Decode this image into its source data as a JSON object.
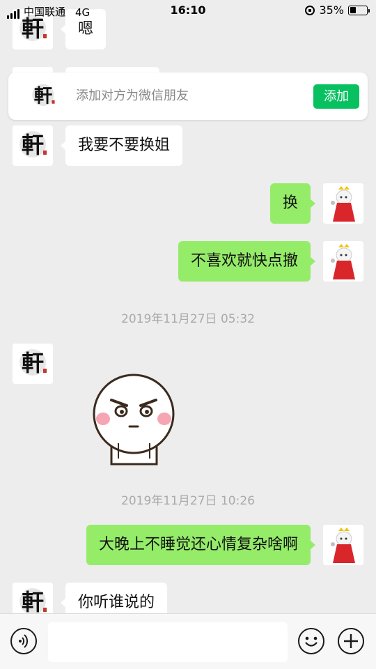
{
  "status_bar": {
    "carrier": "中国联通",
    "network": "4G",
    "time": "16:10",
    "battery_percent_text": "35%",
    "battery_level": 0.35
  },
  "banner": {
    "text": "添加对方为微信朋友",
    "add_label": "添加"
  },
  "messages": [
    {
      "side": "in",
      "text": "嗯"
    },
    {
      "side": "in",
      "text": "我要不要换姐"
    },
    {
      "side": "out",
      "text": "换"
    },
    {
      "side": "out",
      "text": "不喜欢就快点撤"
    },
    {
      "side": "out",
      "text": "大晚上不睡觉还心情复杂啥啊"
    },
    {
      "side": "in",
      "text": "你听谁说的"
    }
  ],
  "timestamps": [
    "2019年11月27日 05:32",
    "2019年11月27日 10:26"
  ],
  "contact_avatar_glyph": "軒",
  "icons": {
    "voice": "voice-icon",
    "emoji": "emoji-icon",
    "more": "plus-icon"
  },
  "colors": {
    "outgoing_bubble": "#95ec69",
    "incoming_bubble": "#ffffff",
    "add_button": "#07c160",
    "background": "#ededed"
  }
}
